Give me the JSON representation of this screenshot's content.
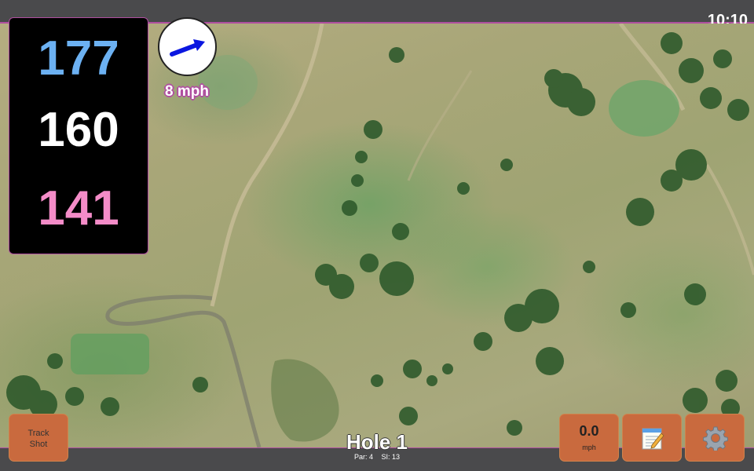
{
  "status_bar": {
    "time": "10:10"
  },
  "distances": {
    "back": "177",
    "middle": "160",
    "front": "141"
  },
  "wind": {
    "speed_label": "8 mph",
    "icon": "wind-arrow-icon",
    "arrow_color": "#0b17e0"
  },
  "hole": {
    "title": "Hole 1",
    "par_label": "Par: 4",
    "si_label": "SI: 13"
  },
  "buttons": {
    "track_shot": "Track\nShot",
    "speed_value": "0.0",
    "speed_unit": "mph",
    "notes_icon": "notepad-icon",
    "settings_icon": "gear-icon"
  },
  "colors": {
    "accent": "#b04fa0",
    "button": "#c96a3e",
    "back_distance": "#6cb1f2",
    "middle_distance": "#ffffff",
    "front_distance": "#f48cc8"
  }
}
